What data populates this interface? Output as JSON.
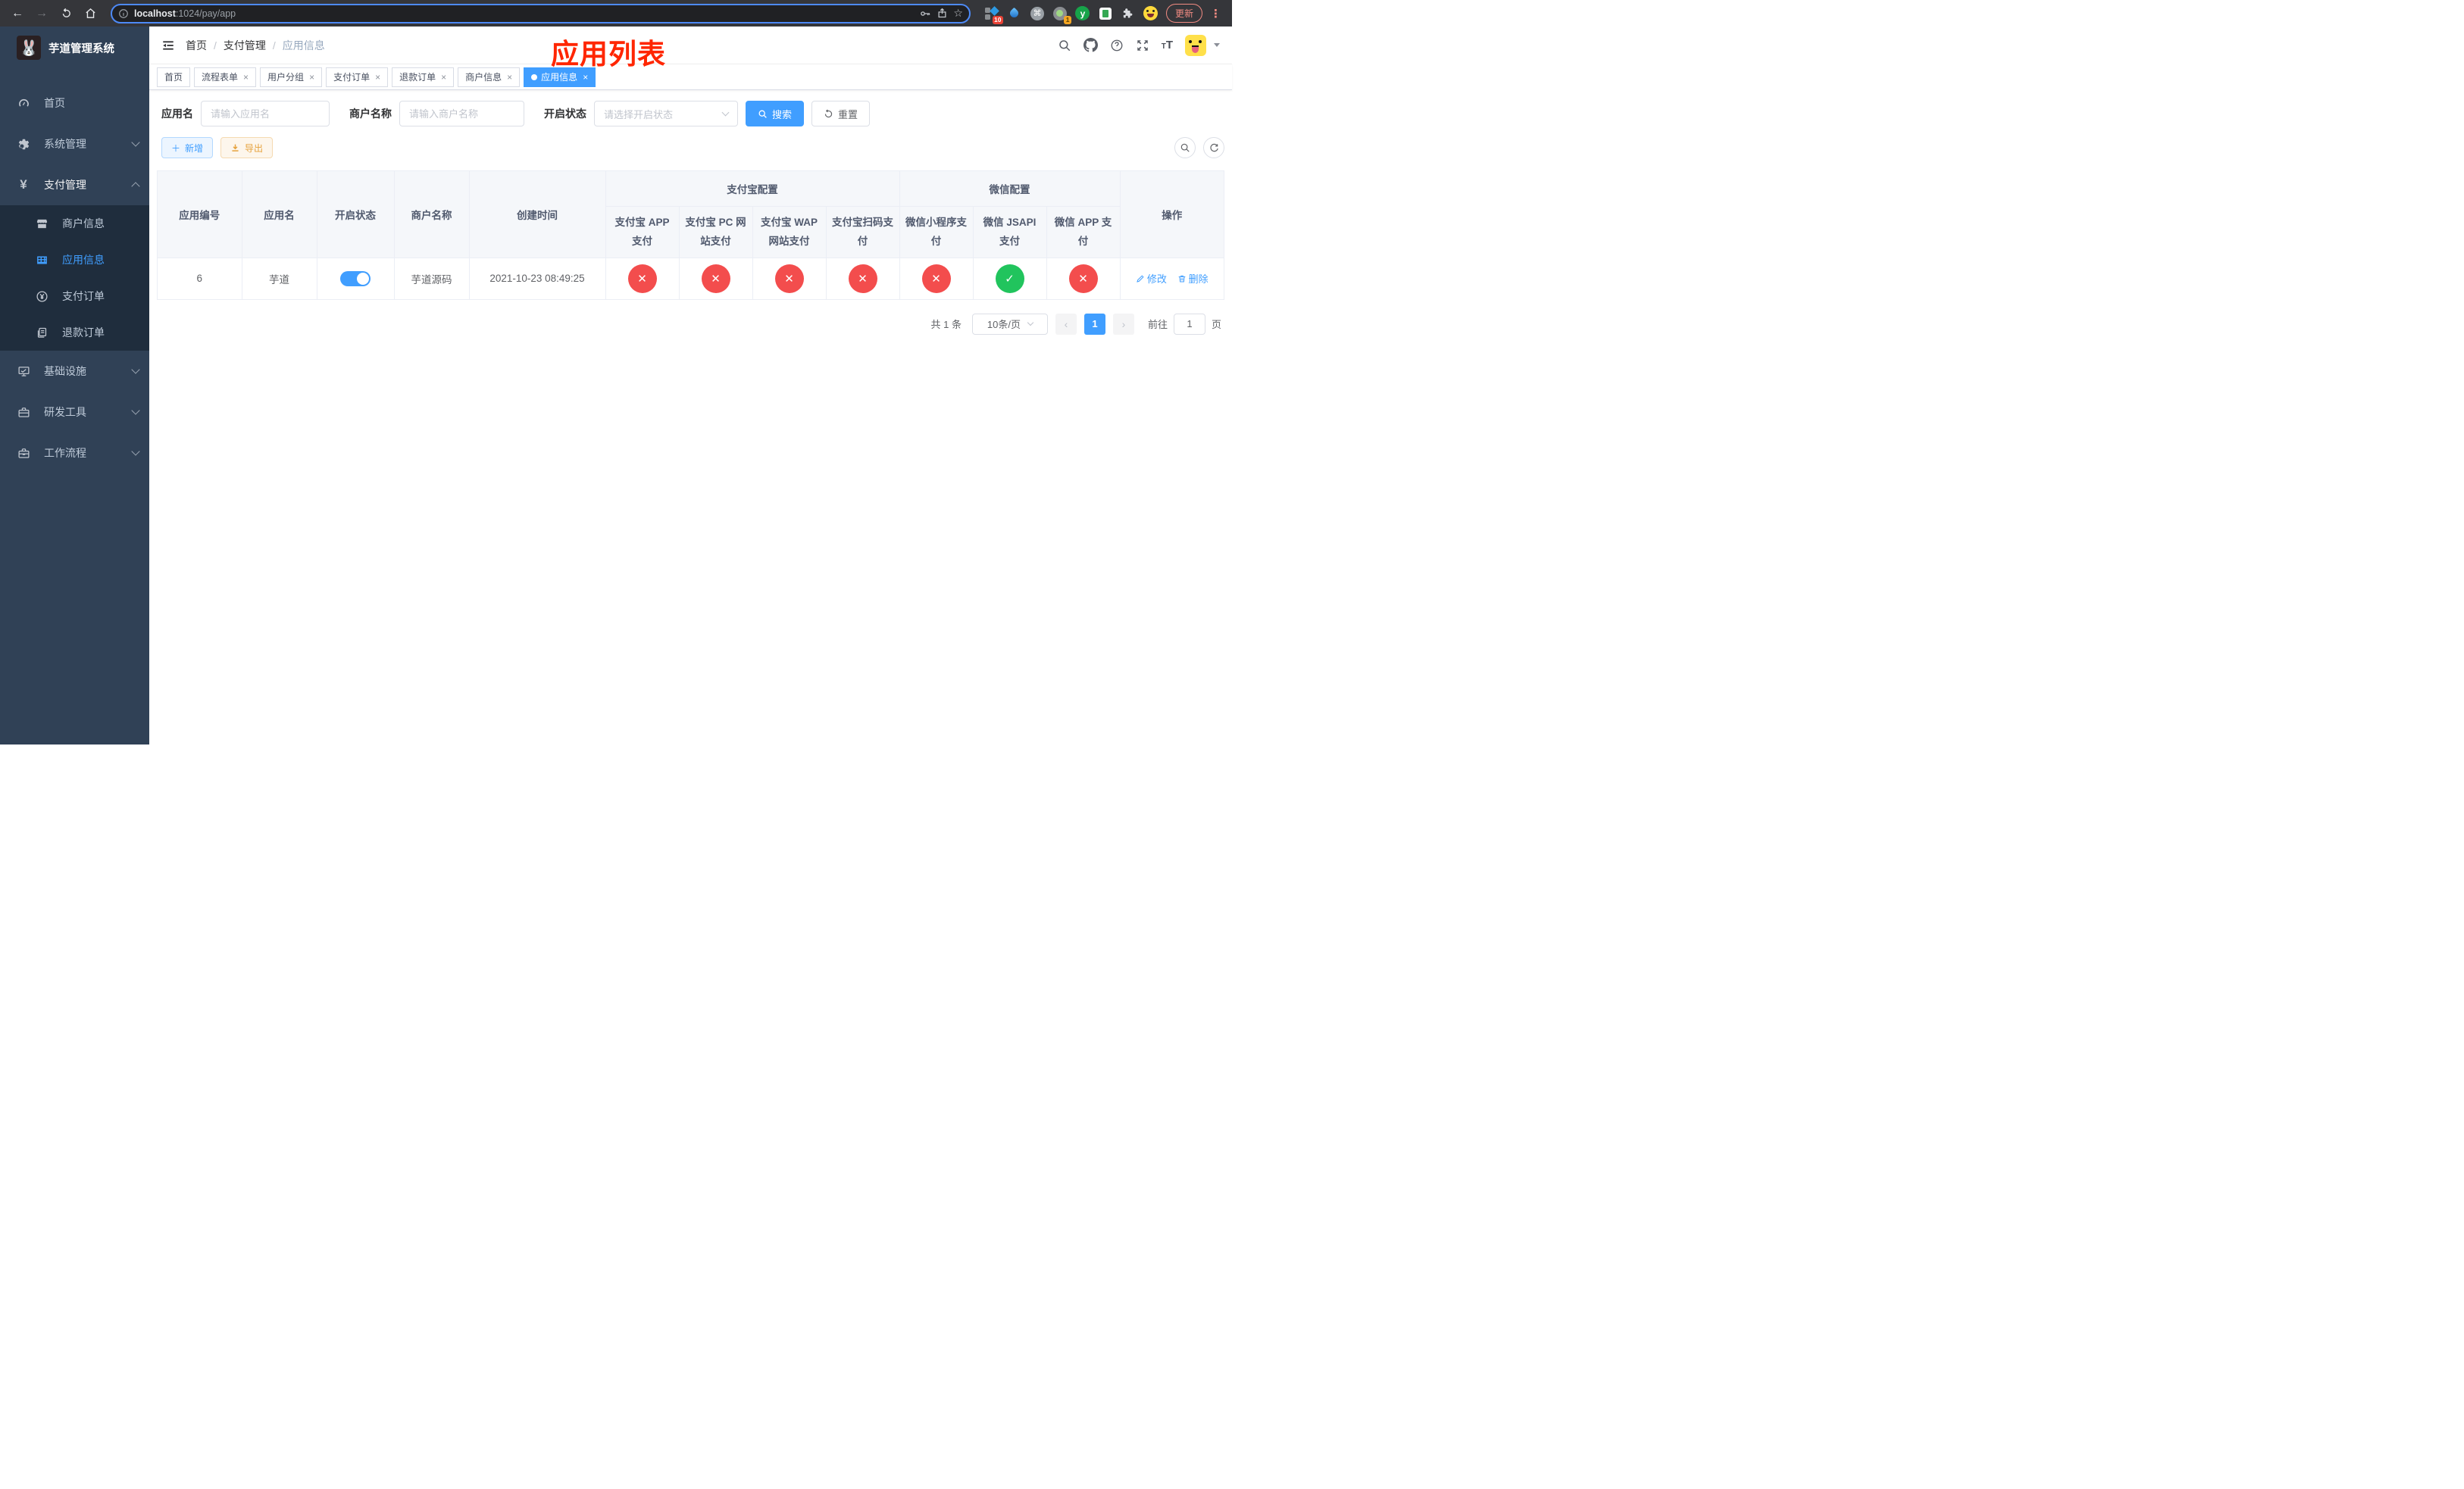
{
  "browser": {
    "url_host": "localhost",
    "url_rest": ":1024/pay/app",
    "update_label": "更新",
    "ext_badge_grid": "10",
    "ext_badge_cam": "1",
    "ext_letter": "y"
  },
  "sidebar": {
    "title": "芋道管理系统",
    "menu_top": [
      {
        "label": "首页"
      },
      {
        "label": "系统管理"
      },
      {
        "label": "支付管理"
      }
    ],
    "submenu": [
      {
        "label": "商户信息"
      },
      {
        "label": "应用信息"
      },
      {
        "label": "支付订单"
      },
      {
        "label": "退款订单"
      }
    ],
    "menu_bottom": [
      {
        "label": "基础设施"
      },
      {
        "label": "研发工具"
      },
      {
        "label": "工作流程"
      }
    ]
  },
  "header": {
    "breadcrumb": [
      "首页",
      "支付管理",
      "应用信息"
    ],
    "separator": "/",
    "annotation": "应用列表"
  },
  "tabs": [
    {
      "label": "首页"
    },
    {
      "label": "流程表单"
    },
    {
      "label": "用户分组"
    },
    {
      "label": "支付订单"
    },
    {
      "label": "退款订单"
    },
    {
      "label": "商户信息"
    },
    {
      "label": "应用信息"
    }
  ],
  "ui": {
    "close": "×",
    "star": "☆",
    "back": "←",
    "forward": "→",
    "dots": "⋮",
    "command": "⌘",
    "prev": "‹",
    "next": "›",
    "plus": "＋",
    "t_small": "T",
    "t_big": "T"
  },
  "filters": {
    "app_name_label": "应用名",
    "app_name_placeholder": "请输入应用名",
    "merchant_label": "商户名称",
    "merchant_placeholder": "请输入商户名称",
    "status_label": "开启状态",
    "status_placeholder": "请选择开启状态",
    "search_button": "搜索",
    "reset_button": "重置"
  },
  "toolbar": {
    "add_button": "新增",
    "export_button": "导出"
  },
  "table": {
    "headers": {
      "id": "应用编号",
      "name": "应用名",
      "status": "开启状态",
      "merchant": "商户名称",
      "created": "创建时间",
      "alipay_group": "支付宝配置",
      "wechat_group": "微信配置",
      "actions": "操作",
      "pay_cols": [
        "支付宝 APP 支付",
        "支付宝 PC 网站支付",
        "支付宝 WAP 网站支付",
        "支付宝扫码支付",
        "微信小程序支付",
        "微信 JSAPI 支付",
        "微信 APP 支付"
      ]
    },
    "row": {
      "id": "6",
      "name": "芋道",
      "enabled": true,
      "merchant": "芋道源码",
      "created": "2021-10-23 08:49:25",
      "statuses": [
        "no",
        "no",
        "no",
        "no",
        "no",
        "yes",
        "no"
      ],
      "edit_label": "修改",
      "delete_label": "删除"
    }
  },
  "pagination": {
    "total": "共 1 条",
    "page_size": "10条/页",
    "page": "1",
    "goto_label": "前往",
    "goto_value": "1",
    "page_unit": "页"
  },
  "colors": {
    "accent": "#409eff",
    "success": "#21c45d",
    "danger": "#f34d4d",
    "annotation": "#ff2600"
  }
}
